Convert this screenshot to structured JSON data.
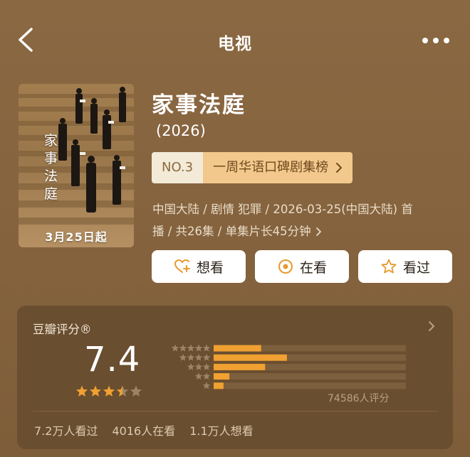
{
  "nav": {
    "title": "电视",
    "back_icon": "chevron-left-icon",
    "more_icon": "more-icon"
  },
  "poster": {
    "title_chars": [
      "家",
      "事",
      "法",
      "庭"
    ],
    "date_text": "3月25日起"
  },
  "show": {
    "title": "家事法庭",
    "year": "(2026)",
    "rank_no": "NO.3",
    "rank_list": "一周华语口碑剧集榜",
    "meta_line1": "中国大陆 / 剧情 犯罪 / 2026-03-25(中国大陆) 首",
    "meta_line2": "播 / 共26集 / 单集片长45分钟"
  },
  "actions": {
    "want": "想看",
    "watching": "在看",
    "watched": "看过"
  },
  "rating": {
    "label": "豆瓣评分®",
    "score": "7.4",
    "stars": 3.5,
    "count": "74586人评分",
    "distribution": [
      0.24,
      0.37,
      0.26,
      0.08,
      0.05
    ],
    "stats": {
      "watched": "7.2万人看过",
      "watching": "4016人在看",
      "want": "1.1万人想看"
    }
  },
  "colors": {
    "background": "#8c6a43",
    "card": "#6a4e30",
    "bar_fill": "#f0a131",
    "bar_track": "#7c5f3d",
    "star_active": "#f0a131",
    "star_inactive": "#9c8466",
    "accent": "#f2c88c"
  }
}
